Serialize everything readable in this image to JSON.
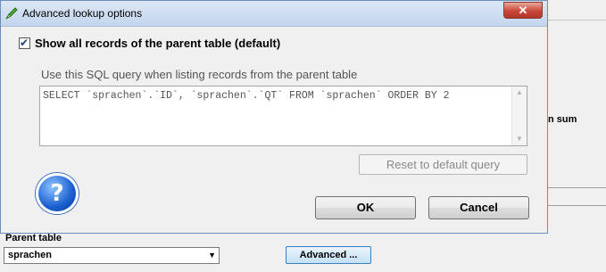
{
  "dialog": {
    "title": "Advanced lookup options",
    "close_label": "✕",
    "show_all_checked": true,
    "show_all_label": "Show all records of the parent table (default)",
    "sql_label": "Use this SQL query when listing records from the parent table",
    "sql_query": "SELECT `sprachen`.`ID`, `sprachen`.`QT` FROM `sprachen` ORDER BY 2",
    "reset_label": "Reset to default query",
    "ok_label": "OK",
    "cancel_label": "Cancel",
    "help_symbol": "?"
  },
  "background": {
    "sum_text": "n sum",
    "parent_table_label": "Parent table",
    "parent_table_value": "sprachen",
    "advanced_label": "Advanced ..."
  },
  "icons": {
    "app": "pencil-leaf-icon",
    "help": "question-mark-icon",
    "close": "close-icon",
    "check": "checkmark-icon",
    "dropdown": "chevron-down-icon"
  },
  "colors": {
    "titlebar": "#c3d6ee",
    "close_button": "#c8473a",
    "help_blue": "#1a5fd0",
    "advanced_button": "#c4e0f7"
  }
}
